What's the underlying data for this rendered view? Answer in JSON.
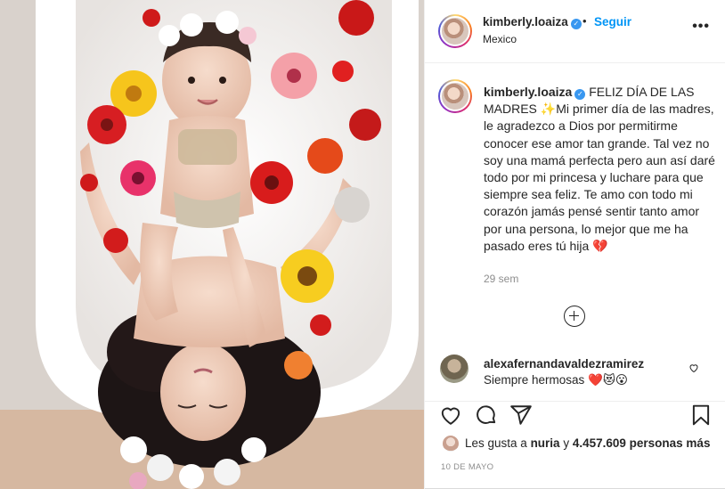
{
  "post": {
    "author": {
      "username": "kimberly.loaiza",
      "verified": true,
      "location": "Mexico",
      "follow_label": "Seguir",
      "separator": "•"
    },
    "caption": {
      "username": "kimberly.loaiza",
      "text_part1": "FELIZ DÍA DE LAS MADRES ",
      "sparkle_emoji": "✨",
      "text_part2": "Mi primer día de las madres, le agradezco a Dios por permitirme conocer ese amor tan grande. Tal vez no soy una mamá perfecta pero aun así daré todo por mi princesa y luchare para que siempre sea feliz. Te amo con todo mi corazón jamás pensé sentir tanto amor por una persona, lo mejor que me ha pasado eres tú hija ",
      "end_emoji": "💔",
      "time_ago": "29 sem"
    },
    "comments": [
      {
        "username": "alexafernandavaldezramirez",
        "text": "Siempre hermosas ",
        "emojis": "❤️😻😮"
      }
    ],
    "likes": {
      "prefix": "Les gusta a ",
      "first_user": "nuria",
      "middle": " y ",
      "count_text": "4.457.609 personas más"
    },
    "date": "10 DE MAYO",
    "icons": {
      "more": "more-options-icon",
      "load_more": "plus-circle-icon",
      "comment_like": "heart-outline-icon",
      "like": "heart-icon",
      "comment": "comment-icon",
      "share": "paper-plane-icon",
      "save": "bookmark-icon"
    },
    "colors": {
      "link_blue": "#0095f6",
      "verified_blue": "#3897f0",
      "secondary_text": "#8e8e8e"
    }
  }
}
